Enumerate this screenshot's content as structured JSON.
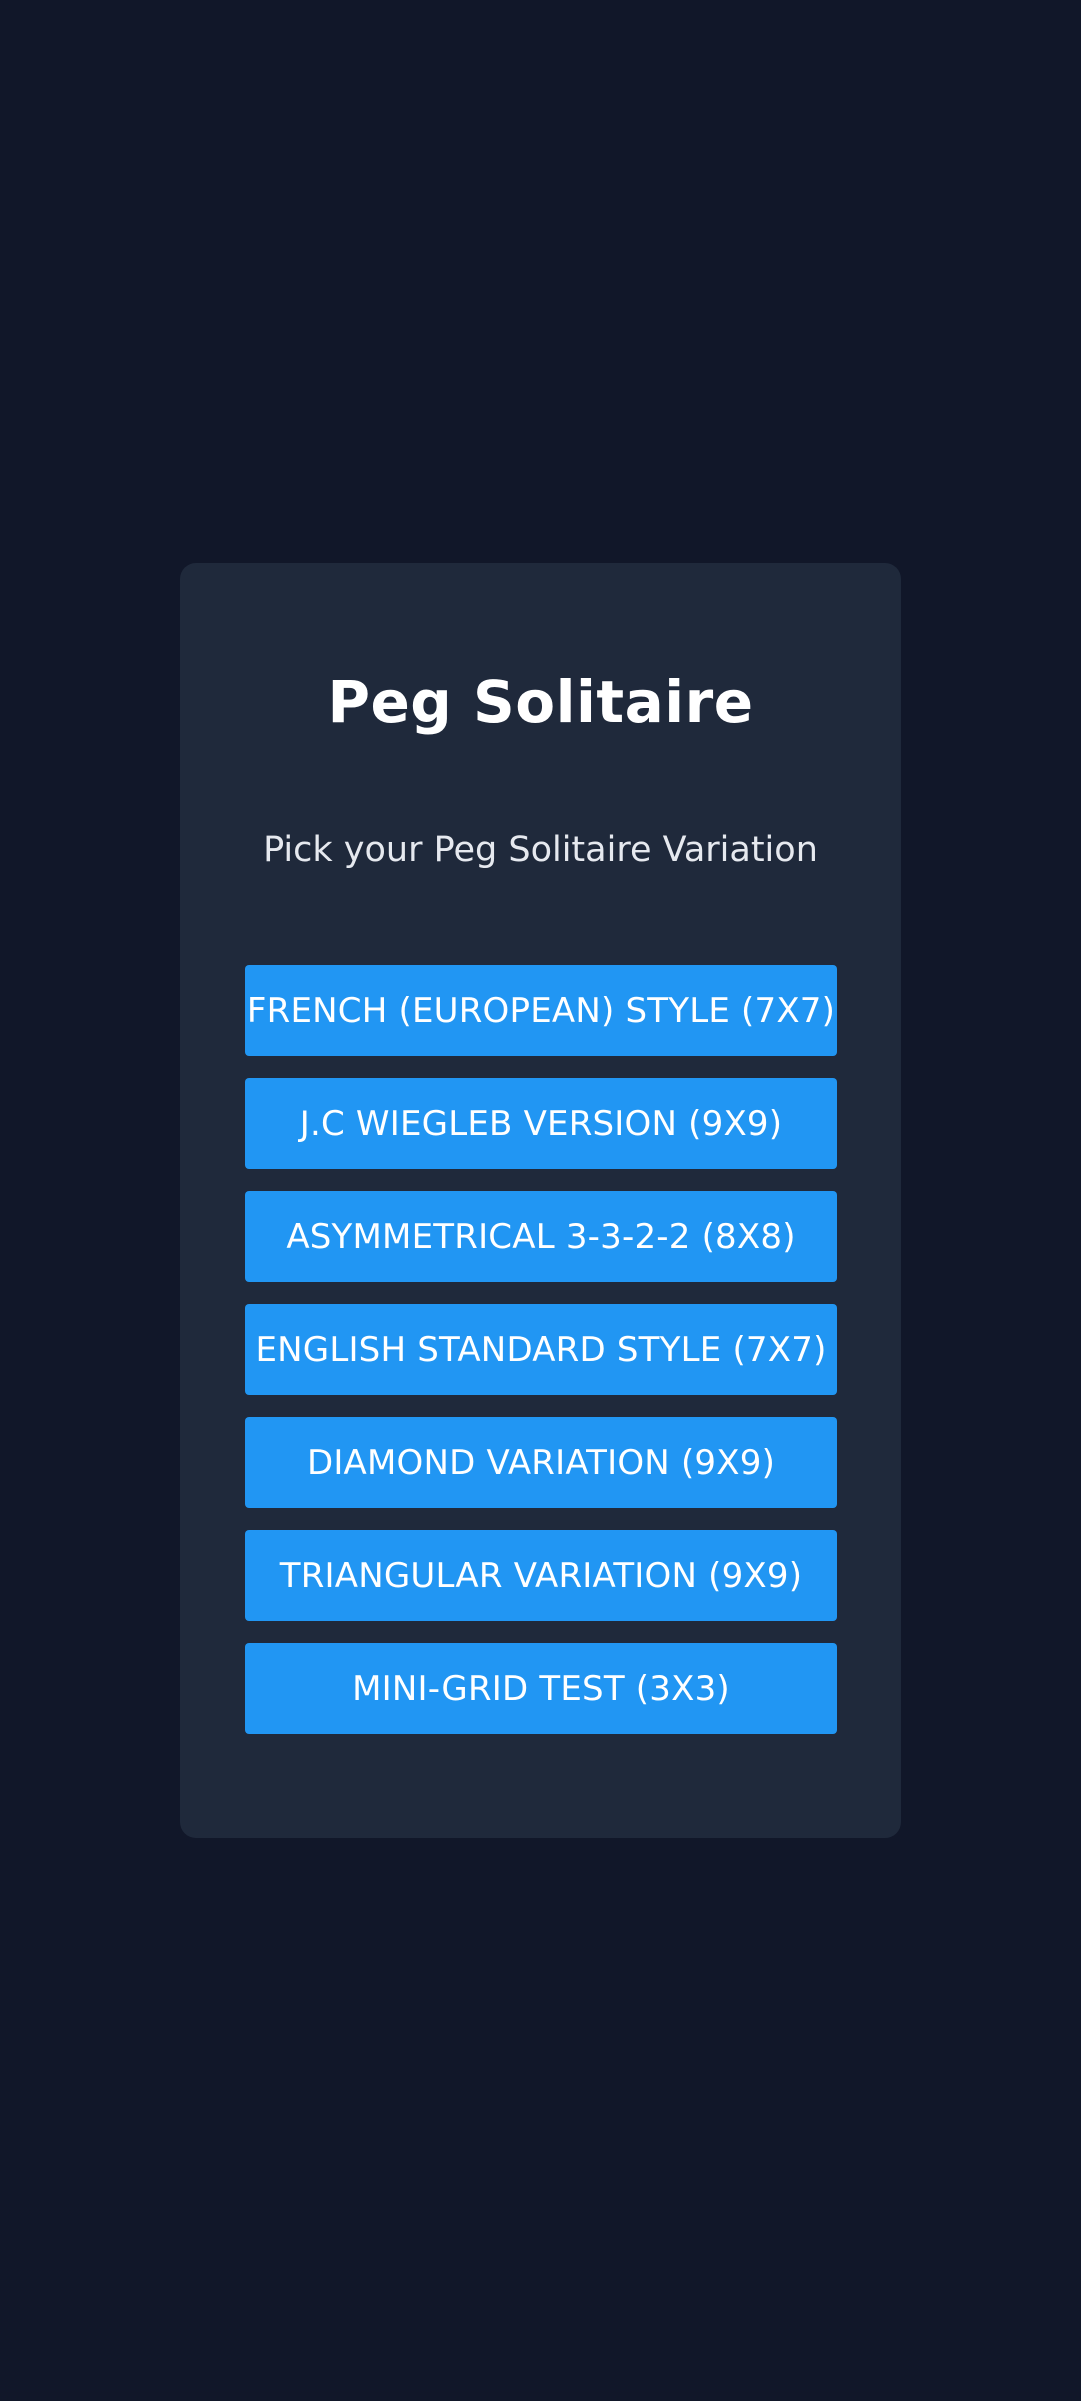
{
  "app": {
    "title": "Peg Solitaire",
    "subtitle": "Pick your Peg Solitaire Variation"
  },
  "variants": [
    {
      "label": "FRENCH (EUROPEAN) STYLE (7X7)"
    },
    {
      "label": "J.C WIEGLEB VERSION (9X9)"
    },
    {
      "label": "ASYMMETRICAL 3-3-2-2 (8X8)"
    },
    {
      "label": "ENGLISH STANDARD STYLE (7X7)"
    },
    {
      "label": "DIAMOND VARIATION (9X9)"
    },
    {
      "label": "TRIANGULAR VARIATION (9X9)"
    },
    {
      "label": "MINI-GRID TEST (3X3)"
    }
  ],
  "colors": {
    "background": "#111729",
    "card": "#1f293b",
    "button": "#2196f3",
    "text": "#ffffff"
  }
}
